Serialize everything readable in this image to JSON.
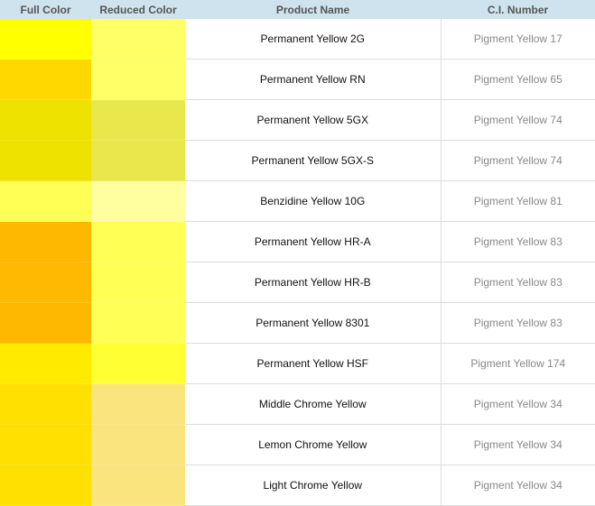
{
  "headers": {
    "full": "Full Color",
    "reduced": "Reduced Color",
    "name": "Product Name",
    "ci": "C.I. Number"
  },
  "rows": [
    {
      "full": "#FFFF00",
      "reduced": "#FFFF66",
      "name": "Permanent Yellow 2G",
      "ci": "Pigment Yellow 17"
    },
    {
      "full": "#FFD800",
      "reduced": "#FFFF66",
      "name": "Permanent Yellow RN",
      "ci": "Pigment Yellow 65"
    },
    {
      "full": "#EEE200",
      "reduced": "#E8E84C",
      "name": "Permanent Yellow 5GX",
      "ci": "Pigment Yellow 74"
    },
    {
      "full": "#EEE200",
      "reduced": "#E8E84C",
      "name": "Permanent Yellow 5GX-S",
      "ci": "Pigment Yellow 74"
    },
    {
      "full": "#FFFF55",
      "reduced": "#FFFFA0",
      "name": "Benzidine Yellow 10G",
      "ci": "Pigment Yellow 81"
    },
    {
      "full": "#FFB800",
      "reduced": "#FFFF55",
      "name": "Permanent Yellow HR-A",
      "ci": "Pigment Yellow 83"
    },
    {
      "full": "#FFBA00",
      "reduced": "#FFFF55",
      "name": "Permanent Yellow HR-B",
      "ci": "Pigment Yellow 83"
    },
    {
      "full": "#FFB800",
      "reduced": "#FFFF55",
      "name": "Permanent Yellow 8301",
      "ci": "Pigment Yellow 83"
    },
    {
      "full": "#FFEA00",
      "reduced": "#FFFF33",
      "name": "Permanent Yellow HSF",
      "ci": "Pigment Yellow 174"
    },
    {
      "full": "#FFE000",
      "reduced": "#FAE47E",
      "name": "Middle Chrome Yellow",
      "ci": "Pigment Yellow 34"
    },
    {
      "full": "#FFE000",
      "reduced": "#FAE47E",
      "name": "Lemon Chrome Yellow",
      "ci": "Pigment Yellow 34"
    },
    {
      "full": "#FFE000",
      "reduced": "#FAE47E",
      "name": "Light Chrome Yellow",
      "ci": "Pigment Yellow 34"
    }
  ]
}
